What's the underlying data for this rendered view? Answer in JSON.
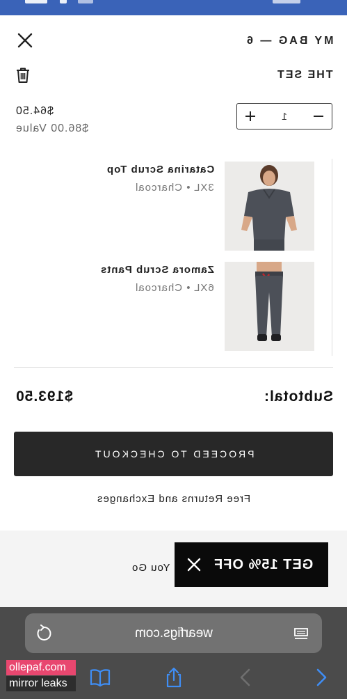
{
  "header": {
    "title": "MY BAG — 6",
    "close_icon": "close-icon"
  },
  "bundle": {
    "name": "THE SET",
    "price": "$64.50",
    "value": "$86.00 Value",
    "quantity": "1",
    "increase_icon": "plus-icon",
    "decrease_icon": "minus-icon",
    "delete_icon": "trash-icon"
  },
  "items": [
    {
      "name": "Catarina Scrub Top",
      "meta": "3XL • Charcoal"
    },
    {
      "name": "Zamora Scrub Pants",
      "meta": "6XL • Charcoal"
    }
  ],
  "summary": {
    "subtotal_label": "Subtotal:",
    "subtotal_amount": "$193.50"
  },
  "checkout": {
    "button_label": "PROCEED TO CHECKOUT",
    "returns_note": "Free Returns and Exchanges"
  },
  "promo": {
    "label": "GET 15% OFF",
    "trailing_text": "You Go",
    "close_icon": "close-icon"
  },
  "browser": {
    "url": "wearfigs.com",
    "reload_icon": "reload-icon",
    "reader_icon": "reader-icon",
    "toolbar": [
      "back-icon",
      "forward-icon",
      "share-icon",
      "bookmarks-icon"
    ]
  },
  "watermark": {
    "line1": "ollepaf.com",
    "line2": "mirror leaks"
  },
  "colors": {
    "status_bar": "#3a63b8",
    "checkout_button": "#282828",
    "promo_bg": "#0a0a0a",
    "browser_chrome": "#4b4b4b",
    "browser_accent": "#3f8ef5",
    "watermark_pink": "#e8476f"
  }
}
